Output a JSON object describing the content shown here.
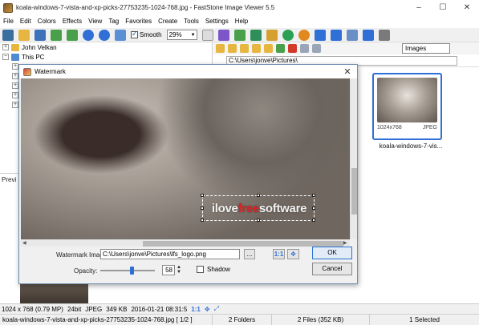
{
  "window": {
    "title": "koala-windows-7-vista-and-xp-picks-27753235-1024-768.jpg  -  FastStone Image Viewer 5.5",
    "min_glyph": "–",
    "max_glyph": "☐",
    "close_glyph": "✕"
  },
  "menu": [
    "File",
    "Edit",
    "Colors",
    "Effects",
    "View",
    "Tag",
    "Favorites",
    "Create",
    "Tools",
    "Settings",
    "Help"
  ],
  "toolbar": {
    "smooth_label": "Smooth",
    "smooth_checked": true,
    "zoom_value": "29%",
    "sort_value": "Images"
  },
  "tree": {
    "items": [
      {
        "label": "John Velkan",
        "icon": "user-folder-icon"
      },
      {
        "label": "This PC",
        "icon": "computer-icon"
      }
    ]
  },
  "preview": {
    "label": "Previ"
  },
  "browser": {
    "path": "C:\\Users\\jonve\\Pictures\\",
    "thumbnail": {
      "dimensions": "1024x768",
      "format": "JPEG",
      "name": "koala-windows-7-vis..."
    }
  },
  "dialog": {
    "title": "Watermark",
    "watermark_text_part1": "ilove",
    "watermark_text_part2": "free",
    "watermark_text_part3": "software",
    "image_label": "Watermark Image:",
    "image_path": "C:\\Users\\jonve\\Pictures\\lfs_logo.png",
    "browse_label": "...",
    "one_to_one_label": "1:1",
    "opacity_label": "Opacity:",
    "opacity_value": "58",
    "shadow_label": "Shadow",
    "shadow_checked": false,
    "ok_label": "OK",
    "cancel_label": "Cancel"
  },
  "infobar": {
    "resolution": "1024 x 768 (0.79 MP)",
    "bit_depth": "24bit",
    "format": "JPEG",
    "size": "349 KB",
    "date": "2016-01-21 08:31:5",
    "ratio": "1:1"
  },
  "statusbar": {
    "filename": "koala-windows-7-vista-and-xp-picks-27753235-1024-768.jpg [ 1/2 ]",
    "folders": "2 Folders",
    "files": "2 Files (352 KB)",
    "selected": "1 Selected"
  },
  "colors": {
    "accent": "#2f6fd6",
    "watermark_red": "#e02020"
  }
}
